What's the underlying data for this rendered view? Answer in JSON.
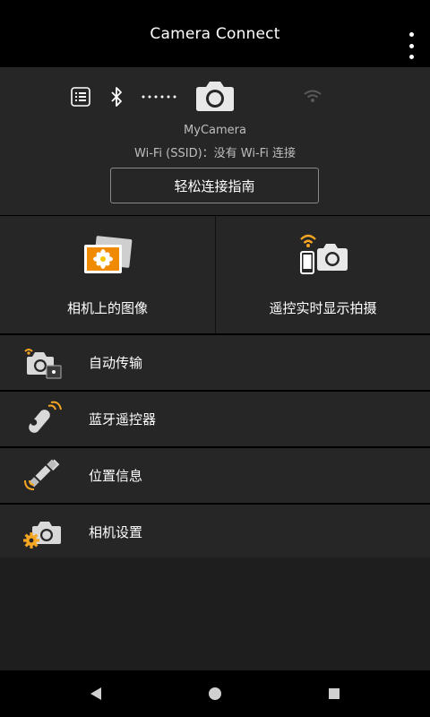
{
  "app_bar": {
    "title": "Camera Connect",
    "menu_icon": "more-vert-icon"
  },
  "status": {
    "icons": [
      "list-icon",
      "bluetooth-icon",
      "dotted-link-icon",
      "camera-icon",
      "wifi-icon"
    ],
    "camera_name": "MyCamera",
    "wifi_ssid": "Wi-Fi (SSID)：没有 Wi-Fi 连接",
    "guide_button_label": "轻松连接指南"
  },
  "tiles": [
    {
      "label": "相机上的图像",
      "icon": "gallery-icon"
    },
    {
      "label": "遥控实时显示拍摄",
      "icon": "remote-live-view-icon"
    }
  ],
  "menu": [
    {
      "label": "自动传输",
      "icon": "auto-transfer-icon"
    },
    {
      "label": "蓝牙遥控器",
      "icon": "bluetooth-remote-icon"
    },
    {
      "label": "位置信息",
      "icon": "location-satellite-icon"
    },
    {
      "label": "相机设置",
      "icon": "camera-settings-icon"
    }
  ],
  "colors": {
    "background": "#000000",
    "panel": "#262626",
    "accent": "#f5a623",
    "secondary_text": "#bdbdbd"
  },
  "nav": [
    "back-icon",
    "home-icon",
    "recents-icon"
  ]
}
